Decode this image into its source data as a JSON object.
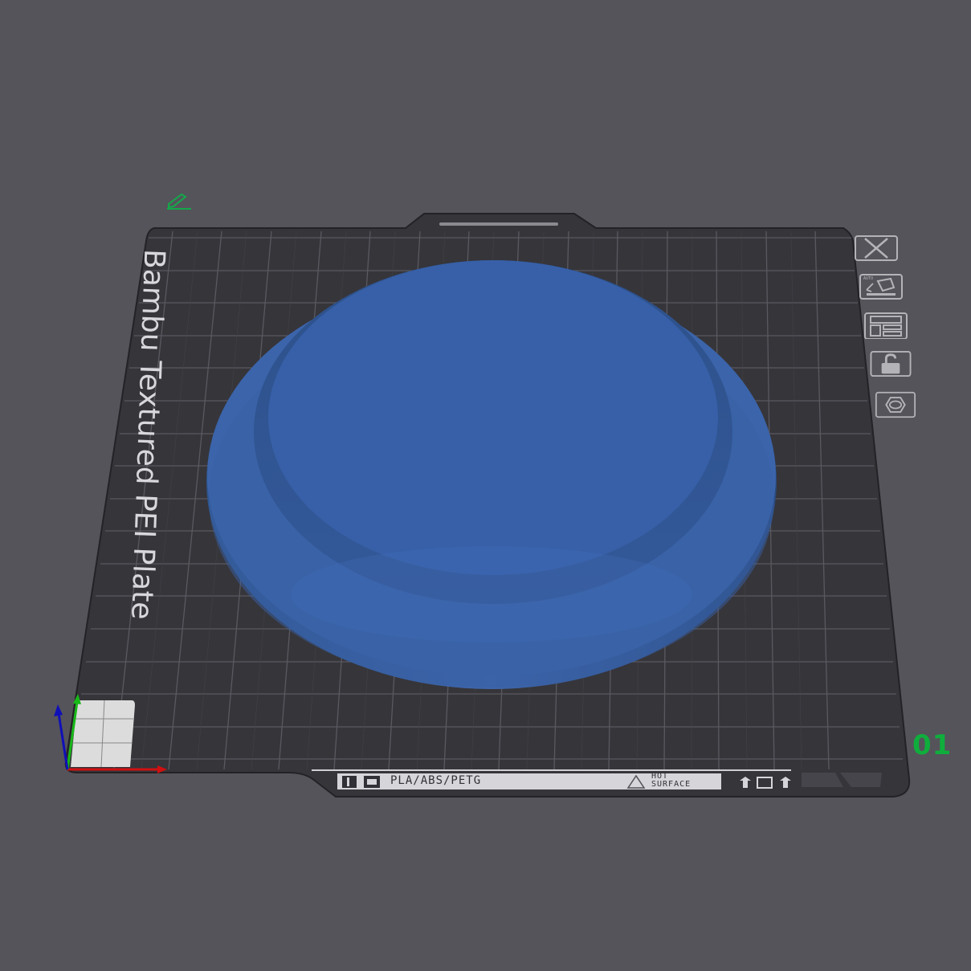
{
  "plate": {
    "title": "Bambu Textured PEI Plate",
    "number": "01",
    "filament_label": "PLA/ABS/PETG",
    "hot_surface": [
      "HOT",
      "SURFACE"
    ]
  },
  "toolbar": {
    "items": [
      {
        "name": "delete-plate-button",
        "icon": "close-icon"
      },
      {
        "name": "auto-orient-button",
        "icon": "auto-orient-icon"
      },
      {
        "name": "arrange-button",
        "icon": "arrange-icon"
      },
      {
        "name": "lock-plate-button",
        "icon": "lock-icon"
      },
      {
        "name": "plate-settings-button",
        "icon": "hexagon-settings-icon"
      }
    ]
  },
  "colors": {
    "background": "#55545a",
    "plate": "#36353a",
    "grid": "#5a5960",
    "model": "#3a63ab",
    "plate_number": "#0fae3c",
    "axis_x": "#d01010",
    "axis_y": "#18b818",
    "axis_z": "#1010b8"
  }
}
